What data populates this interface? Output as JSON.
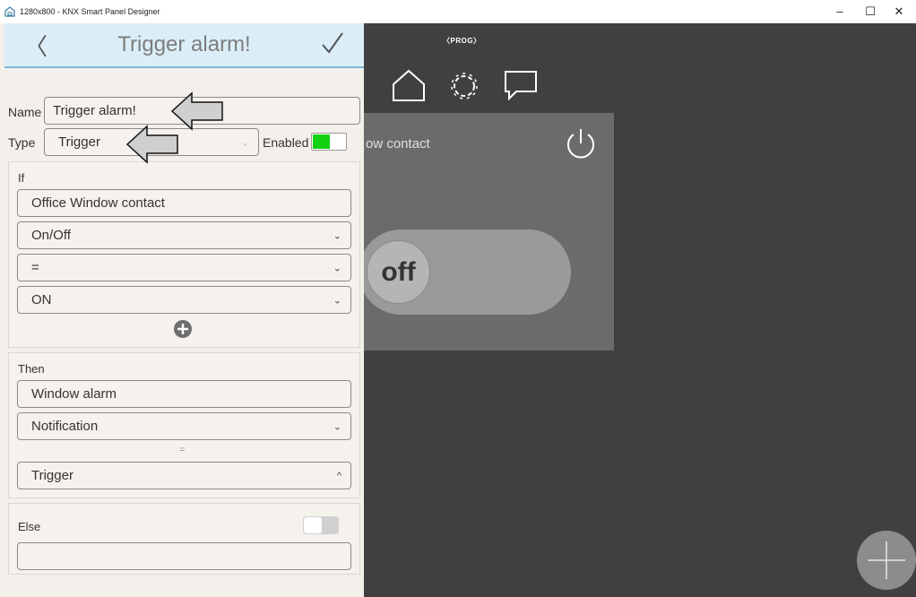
{
  "window": {
    "title": "1280x800 - KNX Smart Panel Designer",
    "minimize": "–",
    "maximize": "☐",
    "close": "✕"
  },
  "panel": {
    "title": "Trigger alarm!",
    "name_label": "Name",
    "name_value": "Trigger alarm!",
    "type_label": "Type",
    "type_value": "Trigger",
    "enabled_label": "Enabled",
    "enabled": true,
    "if": {
      "label": "If",
      "object": "Office Window contact",
      "property": "On/Off",
      "operator": "=",
      "value": "ON"
    },
    "then": {
      "label": "Then",
      "object": "Window alarm",
      "property": "Notification",
      "operator": "=",
      "value": "Trigger"
    },
    "else": {
      "label": "Else",
      "enabled": false,
      "object": ""
    }
  },
  "background": {
    "prog_label": "PROG",
    "tile_title": "ow contact",
    "toggle_state": "off"
  },
  "colors": {
    "accent": "#12d312",
    "header_bg": "#dbeef7",
    "app_bg": "#404040"
  }
}
